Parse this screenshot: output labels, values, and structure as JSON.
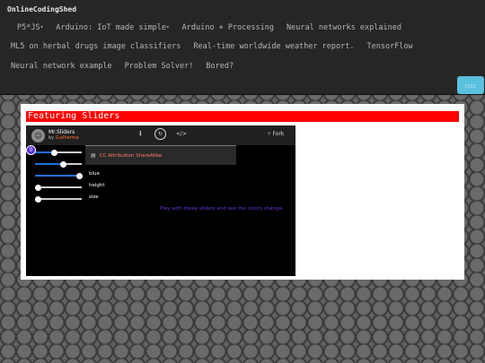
{
  "navbar": {
    "brand": "OnlineCodingShed",
    "row1": [
      {
        "label": "P5*JS",
        "dropdown": true
      },
      {
        "label": "Arduino: IoT made simple",
        "dropdown": true
      },
      {
        "label": "Arduino + Processing",
        "dropdown": false
      },
      {
        "label": "Neural networks explained",
        "dropdown": false
      }
    ],
    "row2": [
      {
        "label": "ML5 on herbal drugs image classifiers"
      },
      {
        "label": "Real-time worldwide weather report."
      },
      {
        "label": "TensorFlow"
      }
    ],
    "row3": [
      {
        "label": "Neural network example"
      },
      {
        "label": "Problem Solver!"
      },
      {
        "label": "Bored?"
      }
    ],
    "toggle_label": "☐☐"
  },
  "main": {
    "feature_title": "Featuring Sliders"
  },
  "embed": {
    "sketch_name": "Mr.Sliders",
    "by_label": "by",
    "author": "Guilherme",
    "fork_label": "Fork",
    "license": "CC Attribution ShareAlike",
    "cursor_label": "0",
    "sliders": [
      {
        "label": "red",
        "value": 0.4
      },
      {
        "label": "green",
        "value": 0.6
      },
      {
        "label": "blue",
        "value": 0.95
      },
      {
        "label": "height",
        "value": 0.05
      },
      {
        "label": "size",
        "value": 0.05
      }
    ],
    "hint": "Play with these sliders and see the colors change."
  },
  "colors": {
    "accent_red": "#ff0000",
    "toggle_blue": "#5bc0de",
    "slider_blue": "#1a6fd8",
    "hint_purple": "#6a35d9"
  }
}
